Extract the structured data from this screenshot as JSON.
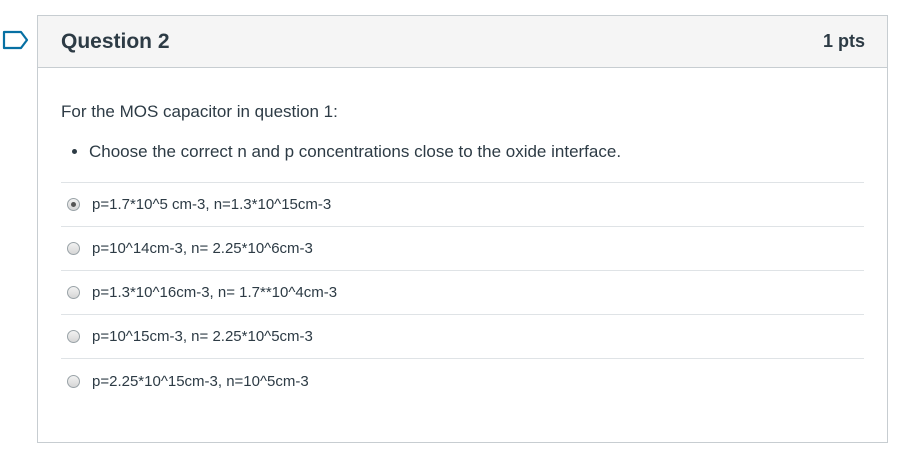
{
  "question": {
    "title": "Question 2",
    "points": "1 pts",
    "intro": "For the MOS capacitor in question 1:",
    "bullets": [
      "Choose the correct n and p concentrations close to the oxide interface."
    ],
    "answers": [
      {
        "label": "p=1.7*10^5 cm-3, n=1.3*10^15cm-3",
        "selected": true
      },
      {
        "label": "p=10^14cm-3, n= 2.25*10^6cm-3",
        "selected": false
      },
      {
        "label": "p=1.3*10^16cm-3, n= 1.7**10^4cm-3",
        "selected": false
      },
      {
        "label": "p=10^15cm-3, n= 2.25*10^5cm-3",
        "selected": false
      },
      {
        "label": "p=2.25*10^15cm-3, n=10^5cm-3",
        "selected": false
      }
    ]
  },
  "colors": {
    "flag": "#0770a3",
    "header_bg": "#f5f5f5",
    "border": "#c7cdd1",
    "text": "#2d3b45"
  },
  "icons": {
    "flag": "bookmark-flag-icon"
  }
}
